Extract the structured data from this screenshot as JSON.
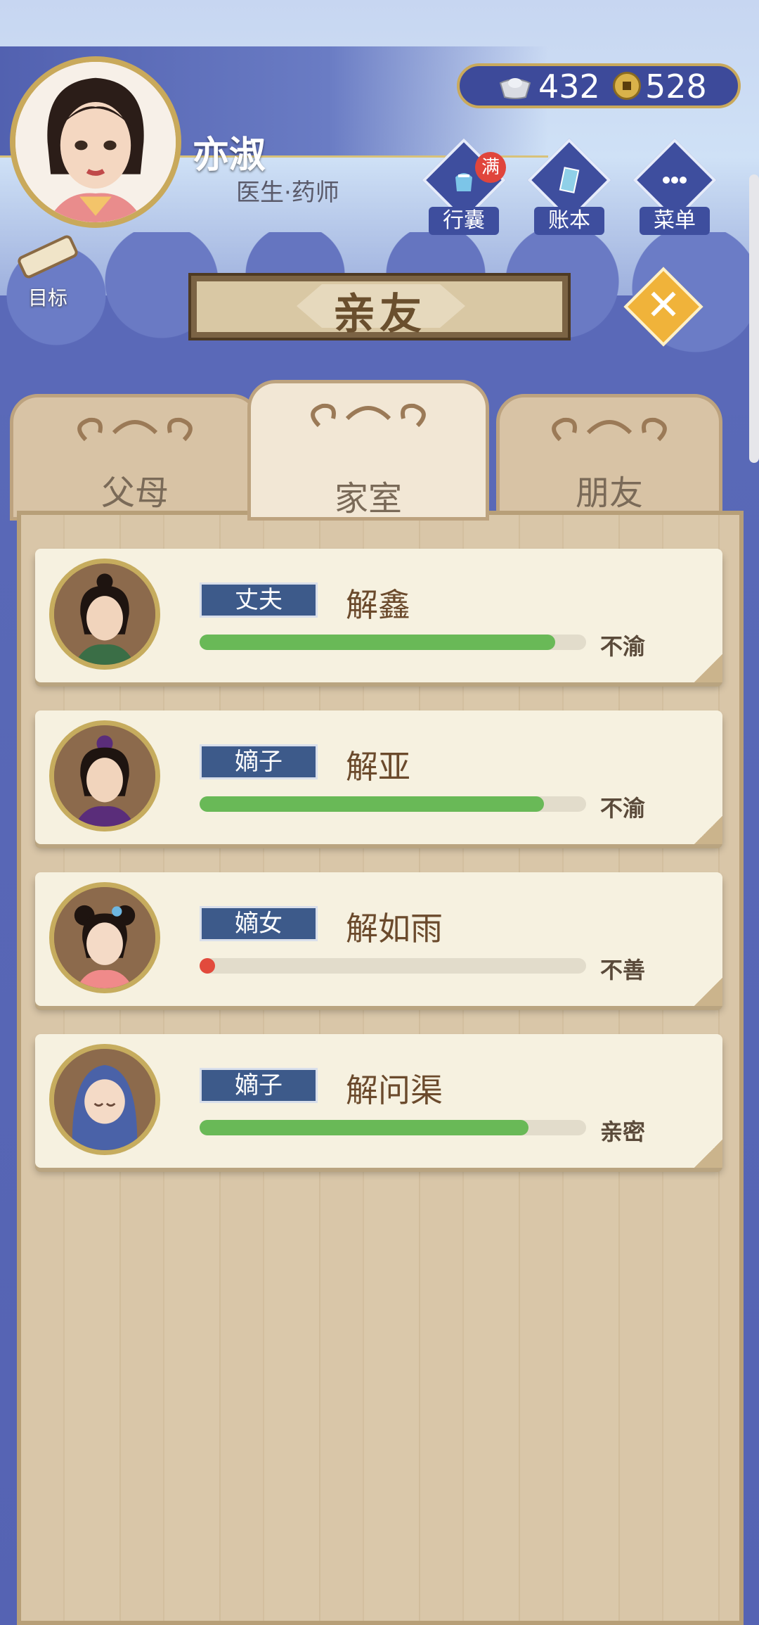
{
  "player": {
    "name": "亦淑",
    "title": "医生·药师",
    "goal_label": "目标"
  },
  "currency": {
    "silver": "432",
    "copper": "528"
  },
  "menu": [
    {
      "label": "行囊",
      "badge": "满",
      "icon": "pouch-icon"
    },
    {
      "label": "账本",
      "icon": "ledger-icon"
    },
    {
      "label": "菜单",
      "icon": "more-dots-icon"
    }
  ],
  "page": {
    "title": "亲友"
  },
  "tabs": [
    {
      "label": "父母",
      "active": false
    },
    {
      "label": "家室",
      "active": true
    },
    {
      "label": "朋友",
      "active": false
    }
  ],
  "relatives": [
    {
      "role": "丈夫",
      "name": "解鑫",
      "affinity": 0.92,
      "status": "不渝"
    },
    {
      "role": "嫡子",
      "name": "解亚",
      "affinity": 0.89,
      "status": "不渝"
    },
    {
      "role": "嫡女",
      "name": "解如雨",
      "affinity": 0.02,
      "status": "不善"
    },
    {
      "role": "嫡子",
      "name": "解问渠",
      "affinity": 0.85,
      "status": "亲密"
    }
  ],
  "colors": {
    "bar_good": "#69b957",
    "bar_bad": "#e24a3c",
    "role_badge": "#3d5a8a"
  }
}
